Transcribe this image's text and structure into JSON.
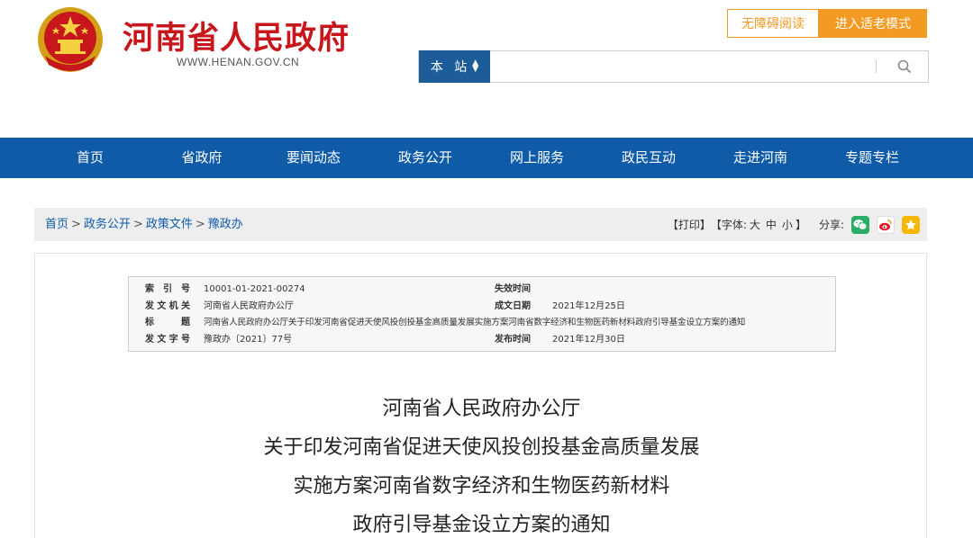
{
  "header": {
    "site_title": "河南省人民政府",
    "site_url": "WWW.HENAN.GOV.CN",
    "accessibility_button": "无障碍阅读",
    "elder_mode_button": "进入适老模式"
  },
  "search": {
    "scope": "本 站",
    "value": "",
    "placeholder": ""
  },
  "nav": {
    "items": [
      "首页",
      "省政府",
      "要闻动态",
      "政务公开",
      "网上服务",
      "政民互动",
      "走进河南",
      "专题专栏"
    ]
  },
  "breadcrumb": {
    "items": [
      "首页",
      "政务公开",
      "政策文件",
      "豫政办"
    ],
    "separator": ">"
  },
  "tools": {
    "print": "【打印】",
    "font_label": "【字体:",
    "font_large": "大",
    "font_medium": "中",
    "font_small": "小",
    "font_close": "】",
    "share_label": "分享:"
  },
  "meta": {
    "index_label": "索 引 号",
    "index_value": "10001-01-2021-00274",
    "effective_label": "失效时间",
    "effective_value": "",
    "issuer_label": "发文机关",
    "issuer_value": "河南省人民政府办公厅",
    "created_label": "成文日期",
    "created_value": "2021年12月25日",
    "title_label": "标 题",
    "title_value": "河南省人民政府办公厅关于印发河南省促进天使风投创投基金高质量发展实施方案河南省数字经济和生物医药新材料政府引导基金设立方案的通知",
    "doc_no_label": "发文字号",
    "doc_no_value": "豫政办〔2021〕77号",
    "published_label": "发布时间",
    "published_value": "2021年12月30日"
  },
  "document": {
    "title_lines": [
      "河南省人民政府办公厅",
      "关于印发河南省促进天使风投创投基金高质量发展",
      "实施方案河南省数字经济和生物医药新材料",
      "政府引导基金设立方案的通知"
    ]
  },
  "colors": {
    "brand_red": "#c8161d",
    "nav_blue": "#0f5ba8",
    "accent_orange": "#f39a23",
    "wechat_green": "#2aae67",
    "weibo_red": "#e6162d",
    "fav_yellow": "#f5b800"
  }
}
